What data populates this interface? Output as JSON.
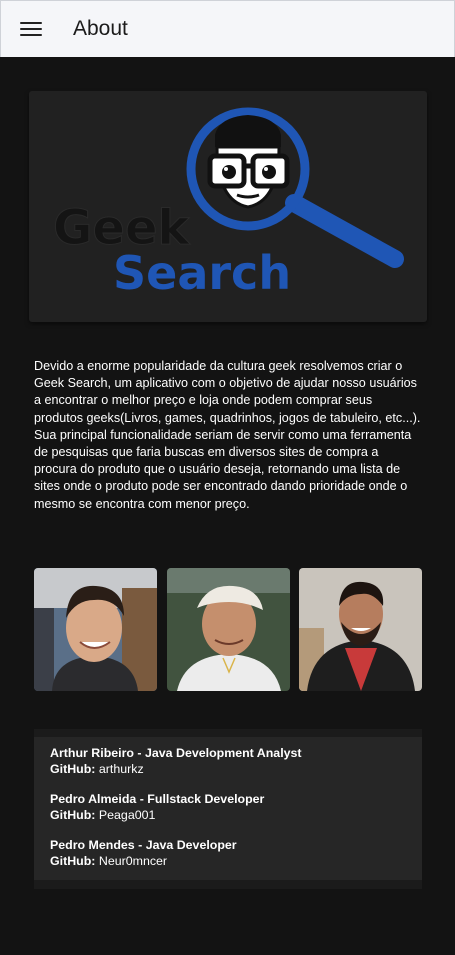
{
  "appbar": {
    "title": "About"
  },
  "logo": {
    "line1": "Geek",
    "line2": "Search"
  },
  "description": "Devido a enorme popularidade da cultura geek resolvemos criar o Geek Search, um aplicativo com o objetivo de ajudar nosso usuários a encontrar o melhor preço e loja onde podem comprar seus produtos geeks(Livros, games, quadrinhos, jogos de tabuleiro, etc...).\nSua principal funcionalidade seriam de servir como uma ferramenta de pesquisas que faria buscas em diversos sites de compra a procura do produto que o usuário deseja, retornando uma lista de sites onde o produto pode ser encontrado dando prioridade onde o mesmo se encontra com menor preço.",
  "team": [
    {
      "name": "Arthur Ribeiro - Java Development Analyst",
      "github_label": "GitHub:",
      "github": "arthurkz"
    },
    {
      "name": "Pedro Almeida - Fullstack Developer",
      "github_label": "GitHub:",
      "github": "Peaga001"
    },
    {
      "name": "Pedro Mendes - Java Developer",
      "github_label": "GitHub:",
      "github": "Neur0mncer"
    }
  ],
  "colors": {
    "background": "#131313",
    "appbar": "#f5f6f9",
    "logo_blue": "#1f56b5",
    "card": "#212121"
  },
  "icons": {
    "menu": "hamburger-menu-icon"
  }
}
